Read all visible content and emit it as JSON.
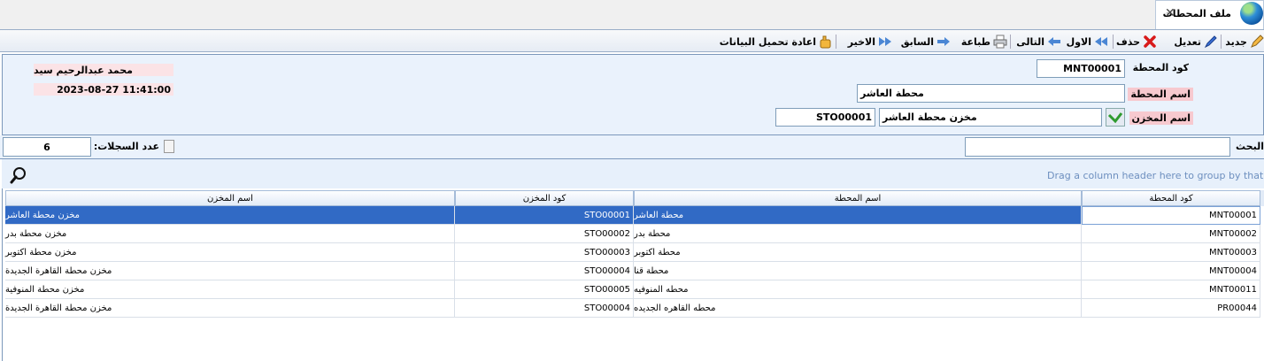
{
  "tab": {
    "title": "ملف المحطات",
    "close": "✕"
  },
  "toolbar": {
    "new": "جديد",
    "edit": "تعديل",
    "delete": "حذف",
    "first": "الاول",
    "next": "التالى",
    "print": "طباعة",
    "previous": "السابق",
    "last": "الاخير",
    "reload": "اعادة تحميل البيانات"
  },
  "form": {
    "station_code_label": "كود المحطة",
    "station_code": "MNT00001",
    "station_name_label": "اسم المحطة",
    "station_name": "محطة العاشر",
    "store_name_label": "اسم المخزن",
    "store_name": "مخزن محطة العاشر",
    "store_code": "STO00001",
    "user_name": "محمد عبدالرحيم سيد",
    "timestamp": "2023-08-27 11:41:00"
  },
  "search": {
    "label": "البحث",
    "value": "",
    "records_label": "عدد السجلات:",
    "records_count": "6"
  },
  "grid": {
    "group_hint": "Drag a column header here to group by that column",
    "columns": [
      "كود المحطة",
      "اسم المحطة",
      "كود المخزن",
      "اسم المخزن"
    ],
    "rows": [
      [
        "MNT00001",
        "محطة العاشر",
        "STO00001",
        "مخزن محطة العاشر"
      ],
      [
        "MNT00002",
        "محطة بدر",
        "STO00002",
        "مخزن محطة بدر"
      ],
      [
        "MNT00003",
        "محطة اكتوبر",
        "STO00003",
        "مخزن محطة اكتوبر"
      ],
      [
        "MNT00004",
        "محطة قنا",
        "STO00004",
        "مخزن محطة القاهرة الجديدة"
      ],
      [
        "MNT00011",
        "محطه المنوفيه",
        "STO00005",
        "مخزن محطة المنوفية"
      ],
      [
        "PR00044",
        "محطه القاهره الجديده",
        "STO00004",
        "مخزن محطة القاهرة الجديدة"
      ]
    ]
  },
  "icons": {
    "new": "pencil-icon",
    "edit": "pen-icon",
    "delete": "red-x-icon",
    "first": "double-arrow-left-icon",
    "next": "arrow-left-icon",
    "print": "printer-icon",
    "previous": "arrow-right-icon",
    "last": "double-arrow-right-icon",
    "reload": "reload-hand-icon"
  }
}
